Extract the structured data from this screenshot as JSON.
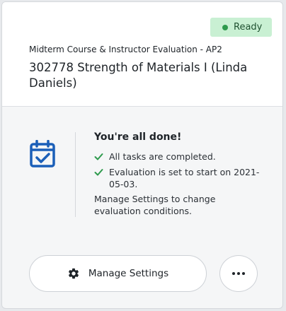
{
  "header": {
    "status": "Ready",
    "evaluation_name": "Midterm Course & Instructor Evaluation - AP2",
    "course_title": "302778 Strength of Materials I (Linda Daniels)"
  },
  "summary": {
    "title": "You're all done!",
    "checks": [
      "All tasks are completed.",
      "Evaluation is set to start on 2021-05-03."
    ],
    "note": "Manage Settings to change evaluation conditions.",
    "icon": "calendar-check-icon"
  },
  "actions": {
    "manage_label": "Manage Settings",
    "more_icon": "ellipsis-icon"
  },
  "colors": {
    "ready_badge_bg": "#c9f0d3",
    "ready_dot": "#2e9a4d",
    "check_green": "#2e9a4d",
    "calendar_blue": "#1b5fb8"
  }
}
